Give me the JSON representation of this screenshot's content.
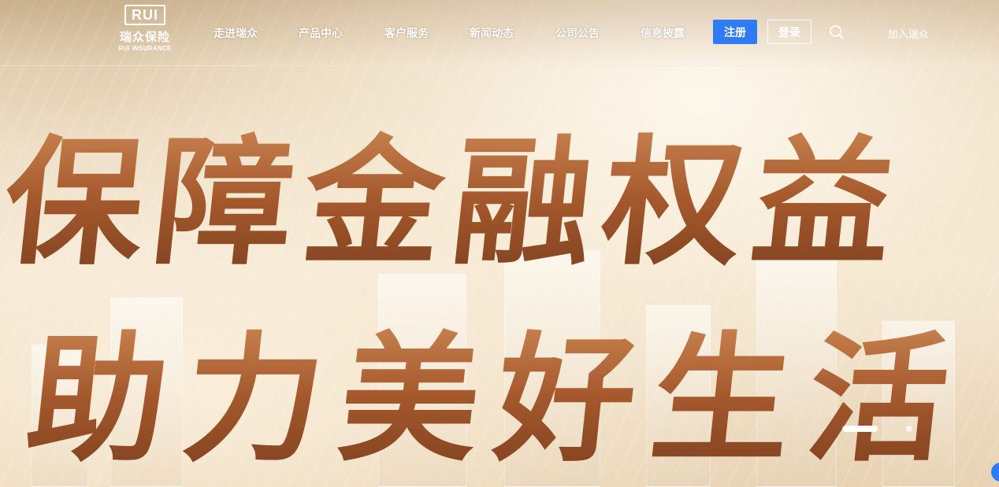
{
  "brand": {
    "logo_mark": "RUI",
    "name_cn": "瑞众保险",
    "name_en": "RUI INSURANCE"
  },
  "nav": {
    "items": [
      {
        "label": "走进瑞众"
      },
      {
        "label": "产品中心"
      },
      {
        "label": "客户服务"
      },
      {
        "label": "新闻动态"
      },
      {
        "label": "公司公告"
      },
      {
        "label": "信息披露"
      }
    ],
    "register_label": "注册",
    "login_label": "登录",
    "join_label": "加入瑞众"
  },
  "hero": {
    "line1": "保障金融权益",
    "line2": "助力美好生活",
    "slides_total": 2,
    "active_slide": 1
  },
  "colors": {
    "register_bg": "#2f7bf5",
    "slogan_gradient_top": "#d9955f",
    "slogan_gradient_bottom": "#7a3e1e"
  },
  "icons": {
    "search": "search-icon",
    "chat": "chat-float-icon"
  }
}
